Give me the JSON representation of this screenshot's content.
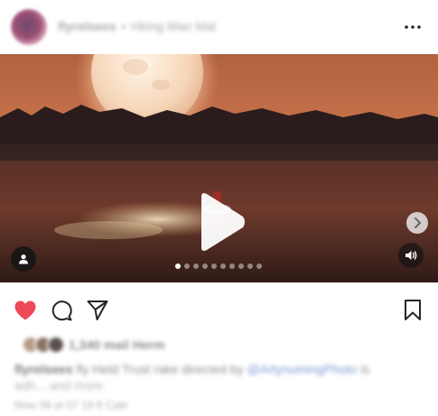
{
  "header": {
    "username": "flyrelsees",
    "subtitle": "Hking Man Mal",
    "more_icon": "more-horizontal-icon"
  },
  "media": {
    "play_icon": "play-icon",
    "next_icon": "chevron-right-icon",
    "tag_icon": "user-tag-icon",
    "sound_icon": "volume-icon",
    "carousel_count": 10,
    "carousel_active": 1
  },
  "actions": {
    "like_icon": "heart-filled-icon",
    "comment_icon": "comment-icon",
    "share_icon": "send-icon",
    "save_icon": "bookmark-icon",
    "like_color": "#ed4956"
  },
  "likes": {
    "text": "1,340 mail Herm"
  },
  "caption": {
    "username": "flyrelsees",
    "text": "fly Held Trust rake directed by",
    "mention": "@ArtynumingPhoto",
    "tail": "is",
    "line2": "adh... and more"
  },
  "timestamp": "Now 08 at 07 19 ft Cale"
}
